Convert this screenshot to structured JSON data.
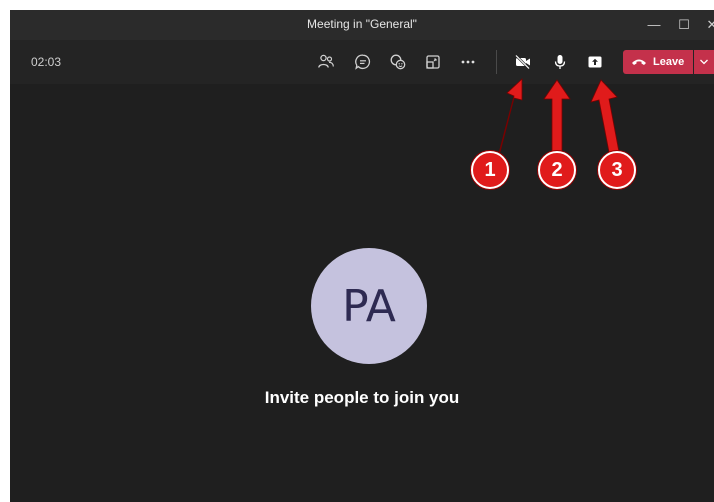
{
  "window": {
    "title": "Meeting in \"General\"",
    "controls": {
      "minimize": "—",
      "maximize": "☐",
      "close": "✕"
    }
  },
  "toolbar": {
    "timer": "02:03",
    "buttons": [
      {
        "name": "participants-icon"
      },
      {
        "name": "chat-icon"
      },
      {
        "name": "reactions-icon"
      },
      {
        "name": "breakout-icon"
      },
      {
        "name": "more-options-icon"
      },
      {
        "name": "camera-off-icon"
      },
      {
        "name": "microphone-icon"
      },
      {
        "name": "share-screen-icon"
      }
    ],
    "leave_label": "Leave"
  },
  "stage": {
    "avatar_initials": "PA",
    "invite_text": "Invite people to join you"
  },
  "annotations": {
    "markers": [
      "1",
      "2",
      "3"
    ],
    "color": "#e01b1b"
  },
  "colors": {
    "leave": "#c4314b",
    "avatar": "#c5c2de",
    "background": "#1f1f1f"
  }
}
